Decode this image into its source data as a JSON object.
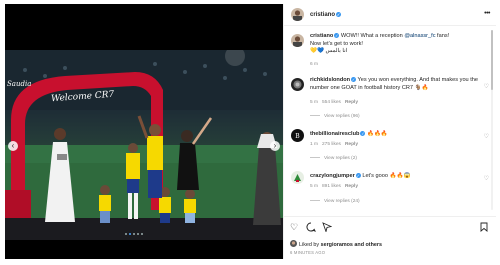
{
  "post": {
    "username": "cristiano",
    "caption_prefix": "WOW!! What a reception ",
    "caption_mention": "@alnassr_fc",
    "caption_suffix": " fans!",
    "caption_line2": "Now let's get to work!",
    "caption_line3": "💛💙 انا بالمس",
    "time": "6 m",
    "liked_by_prefix": "Liked by ",
    "liked_by_user": "sergioramos",
    "liked_by_suffix": " and others",
    "time_ago": "6 MINUTES AGO"
  },
  "photo": {
    "arch_text": "Welcome CR7",
    "arch_brand": "Saudia",
    "carousel_dots": 5,
    "active_dot": 2
  },
  "comments": [
    {
      "username": "richkidslondon",
      "verified": true,
      "text": "Yes you won everything. And that makes you the number one GOAT in football history CR7 🐐🔥",
      "time": "5 m",
      "likes": "554 likes",
      "reply": "Reply",
      "view_replies": "View replies (96)"
    },
    {
      "username": "thebillionairesclub",
      "verified": true,
      "text": "🔥🔥🔥",
      "time": "1 m",
      "likes": "275 likes",
      "reply": "Reply",
      "view_replies": "View replies (2)"
    },
    {
      "username": "crazylongjumper",
      "verified": true,
      "text": "Let's gooo 🔥🔥😱",
      "time": "5 m",
      "likes": "891 likes",
      "reply": "Reply",
      "view_replies": "View replies (24)"
    }
  ],
  "icons": {
    "more": "more-options-icon",
    "heart": "heart-icon",
    "comment": "comment-icon",
    "share": "share-icon",
    "save": "bookmark-icon"
  },
  "colors": {
    "verified": "#3897f0",
    "mention": "#00376b",
    "meta": "#8e8e8e",
    "arch": "#c8102e"
  }
}
